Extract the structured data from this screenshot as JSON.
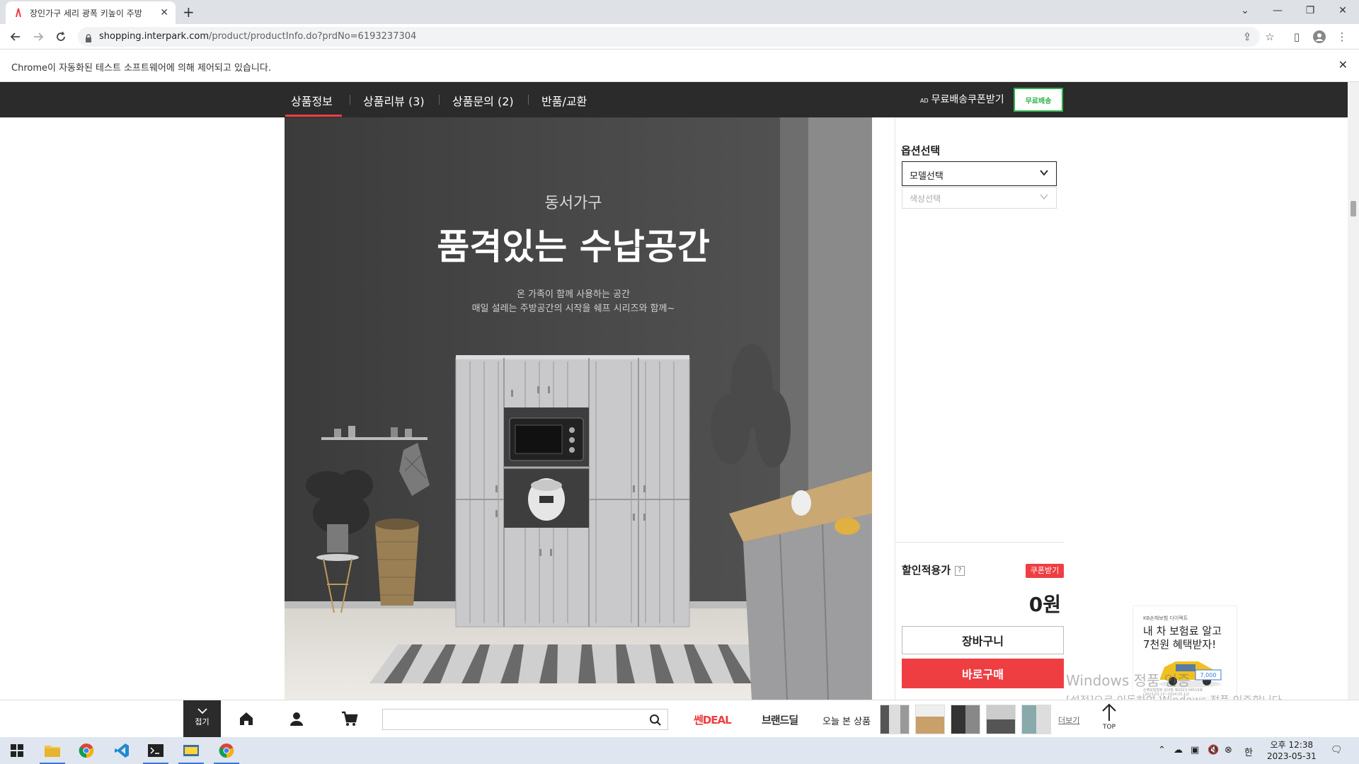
{
  "browser": {
    "tab_title": "장인가구 세리 광폭 키높이 주방",
    "url_host": "shopping.interpark.com",
    "url_path": "/product/productInfo.do?prdNo=6193237304",
    "infobar_message": "Chrome이 자동화된 테스트 소프트웨어에 의해 제어되고 있습니다."
  },
  "nav": {
    "tabs": [
      "상품정보",
      "상품리뷰 (3)",
      "상품문의 (2)",
      "반품/교환"
    ],
    "ad_tag": "AD",
    "coupon_text": "무료배송쿠폰받기",
    "free_ship_badge": "무료배송"
  },
  "product_image": {
    "brand": "동서가구",
    "headline": "품격있는 수납공간",
    "sub1": "온 가족이 함께 사용하는 공간",
    "sub2": "매일 설레는 주방공간의 시작을 쉐프 시리즈와 함께~"
  },
  "options": {
    "title": "옵션선택",
    "model_select": "모델선택",
    "color_select": "색상선택"
  },
  "purchase": {
    "discount_label": "할인적용가",
    "q_mark": "?",
    "coupon_button": "쿠폰받기",
    "price": "0원",
    "cart_button": "장바구니",
    "buy_button": "바로구매"
  },
  "ad": {
    "brand": "KB손해보험 다이렉트",
    "line1": "내 차 보험료 알고",
    "line2": "7천원 혜택받자!",
    "badge": "7,000",
    "fine": "손해보험협회 심의필 제2023-04519호 (2023.03.13~2024.03.12)"
  },
  "watermark": {
    "line1": "Windows 정품 인증",
    "line2": "[설정]으로 이동하여 Windows 정품 인증합니다."
  },
  "quickbar": {
    "fold": "접기",
    "logo1": "쎈DEAL",
    "logo2": "브랜드딜",
    "recent": "오늘 본 상품",
    "more": "더보기",
    "top": "TOP"
  },
  "taskbar": {
    "ime": "한",
    "time": "오후 12:38",
    "date": "2023-05-31"
  },
  "colors": {
    "accent_red": "#ef3e42",
    "nav_dark": "#2b2b2b",
    "free_ship_green": "#2eb24b"
  }
}
